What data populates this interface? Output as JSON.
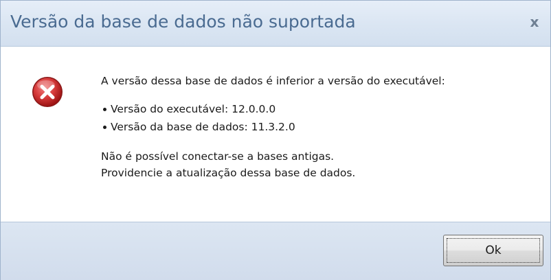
{
  "dialog": {
    "title": "Versão da base de dados não suportada",
    "close_glyph": "x",
    "icon": "error-icon",
    "message": {
      "intro": "A versão dessa base de dados é inferior a versão do executável:",
      "bullets": [
        "Versão do executável: 12.0.0.0",
        "Versão da base de dados: 11.3.2.0"
      ],
      "notes": [
        "Não é possível conectar-se a bases antigas.",
        "Providencie a atualização dessa base de dados."
      ]
    },
    "buttons": {
      "ok_label": "Ok"
    }
  },
  "colors": {
    "title_text": "#4a6b91",
    "error_red": "#c8282a",
    "footer_bg": "#d1dcec"
  }
}
